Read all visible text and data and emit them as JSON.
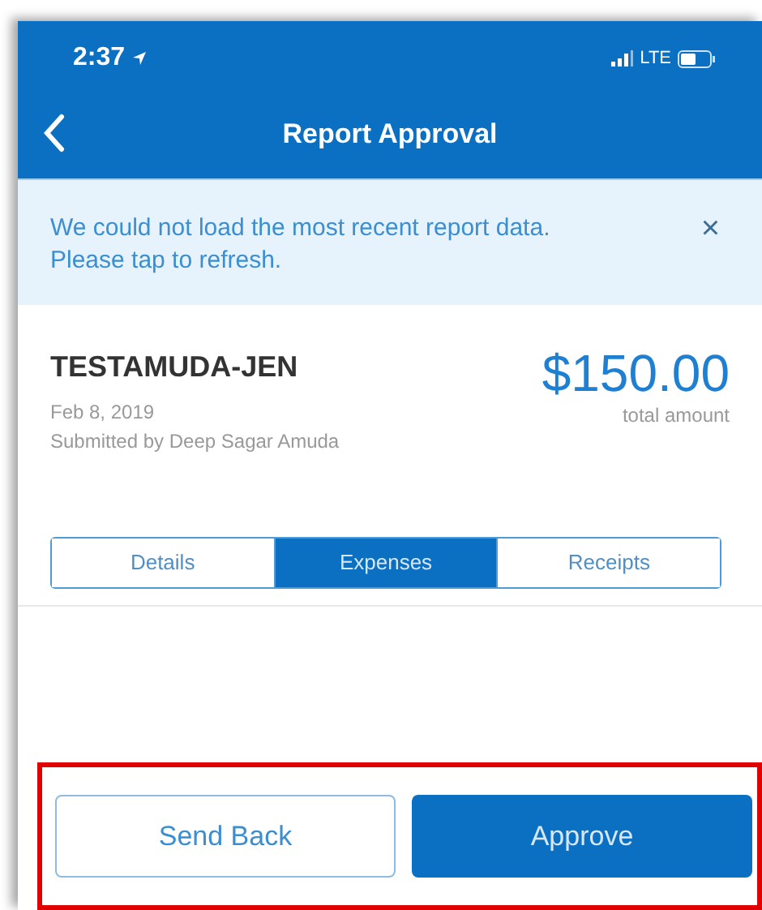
{
  "status_bar": {
    "time": "2:37",
    "network": "LTE"
  },
  "nav": {
    "title": "Report Approval"
  },
  "banner": {
    "message": "We could not load the most recent report data. Please tap to refresh.",
    "close": "×"
  },
  "report": {
    "name": "TESTAMUDA-JEN",
    "date": "Feb 8, 2019",
    "submitter": "Submitted by Deep Sagar Amuda",
    "amount": "$150.00",
    "amount_label": "total amount"
  },
  "tabs": [
    {
      "label": "Details",
      "selected": false
    },
    {
      "label": "Expenses",
      "selected": true
    },
    {
      "label": "Receipts",
      "selected": false
    }
  ],
  "actions": [
    {
      "label": "Send Back",
      "kind": "secondary"
    },
    {
      "label": "Approve",
      "kind": "primary"
    }
  ]
}
